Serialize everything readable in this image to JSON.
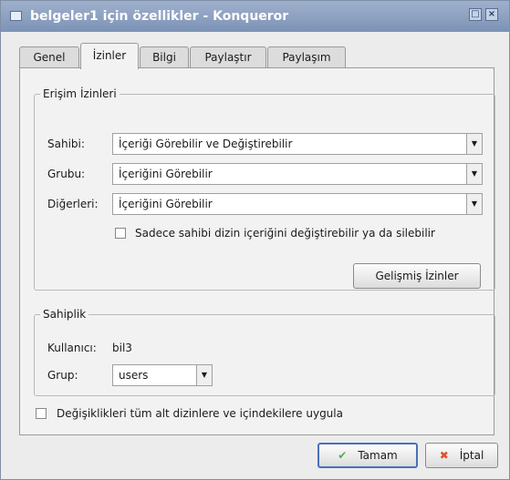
{
  "window": {
    "title": "belgeler1 için özellikler - Konqueror",
    "maximize_glyph": "□",
    "close_glyph": "×"
  },
  "tabs": [
    {
      "label": "Genel"
    },
    {
      "label": "İzinler"
    },
    {
      "label": "Bilgi"
    },
    {
      "label": "Paylaştır"
    },
    {
      "label": "Paylaşım"
    }
  ],
  "permissions": {
    "group_title": "Erişim İzinleri",
    "owner": {
      "label": "Sahibi:",
      "value": "İçeriği Görebilir ve Değiştirebilir"
    },
    "group": {
      "label": "Grubu:",
      "value": "İçeriğini Görebilir"
    },
    "others": {
      "label": "Diğerleri:",
      "value": "İçeriğini Görebilir"
    },
    "only_owner_checkbox": {
      "label": "Sadece sahibi dizin içeriğini değiştirebilir ya da silebilir",
      "checked": false
    },
    "advanced_button": "Gelişmiş İzinler"
  },
  "ownership": {
    "group_title": "Sahiplik",
    "user_label": "Kullanıcı:",
    "user_value": "bil3",
    "group_label": "Grup:",
    "group_value": "users"
  },
  "apply_recursive": {
    "label": "Değişiklikleri tüm alt dizinlere ve içindekilere uygula",
    "checked": false
  },
  "buttons": {
    "ok": {
      "label": "Tamam",
      "icon": "check-icon"
    },
    "cancel": {
      "label": "İptal",
      "icon": "cancel-x-icon"
    }
  },
  "colors": {
    "titlebar": "#8ea2c2",
    "ok_check": "#4caf50",
    "cancel_x": "#e0502a"
  }
}
